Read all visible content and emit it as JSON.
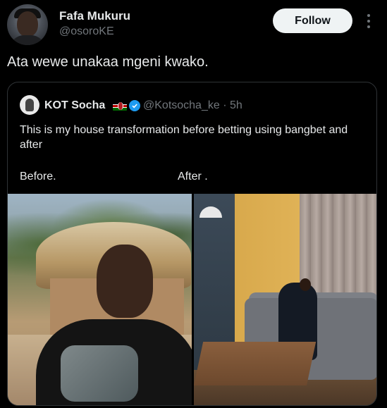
{
  "header": {
    "name": "Fafa Mukuru",
    "handle": "@osoroKE",
    "follow_label": "Follow"
  },
  "tweet": {
    "text": "Ata wewe unakaa mgeni kwako."
  },
  "quote": {
    "name": "KOT Socha",
    "handle_time": "@Kotsocha_ke · 5h",
    "text": "This is my house transformation before betting using bangbet and after",
    "label_before": "Before.",
    "label_after": "After ."
  },
  "colors": {
    "background": "#000000",
    "text": "#e7e9ea",
    "secondary": "#71767b",
    "border": "#2f3336",
    "verified": "#1d9bf0",
    "follow_bg": "#eff3f4"
  },
  "icons": [
    "more-icon",
    "kenya-flag-icon",
    "verified-icon"
  ]
}
